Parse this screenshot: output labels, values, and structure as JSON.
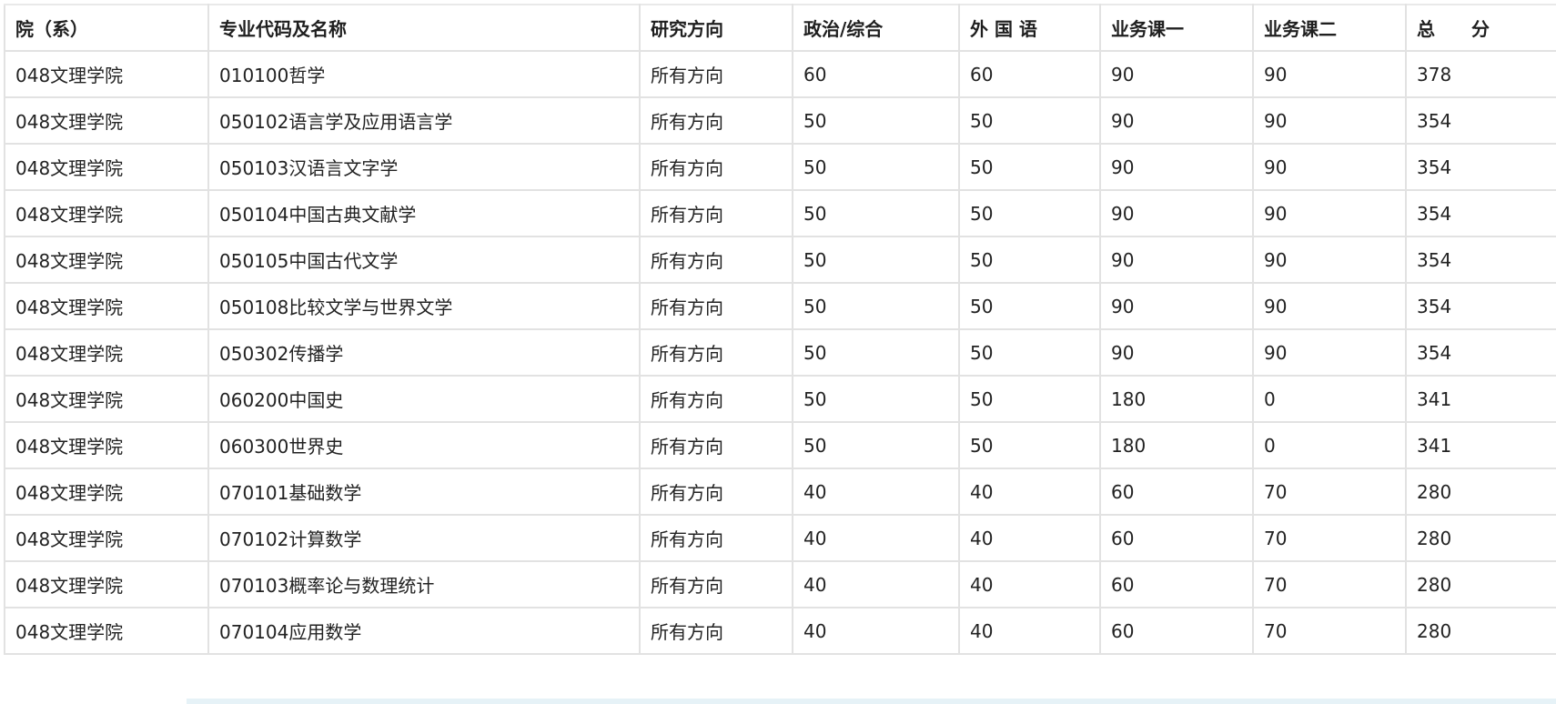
{
  "table": {
    "headers": [
      "院（系）",
      "专业代码及名称",
      "研究方向",
      "政治/综合",
      "外 国 语",
      "业务课一",
      "业务课二",
      "总　　分"
    ],
    "rows": [
      [
        "048文理学院",
        "010100哲学",
        "所有方向",
        "60",
        "60",
        "90",
        "90",
        "378"
      ],
      [
        "048文理学院",
        "050102语言学及应用语言学",
        "所有方向",
        "50",
        "50",
        "90",
        "90",
        "354"
      ],
      [
        "048文理学院",
        "050103汉语言文字学",
        "所有方向",
        "50",
        "50",
        "90",
        "90",
        "354"
      ],
      [
        "048文理学院",
        "050104中国古典文献学",
        "所有方向",
        "50",
        "50",
        "90",
        "90",
        "354"
      ],
      [
        "048文理学院",
        "050105中国古代文学",
        "所有方向",
        "50",
        "50",
        "90",
        "90",
        "354"
      ],
      [
        "048文理学院",
        "050108比较文学与世界文学",
        "所有方向",
        "50",
        "50",
        "90",
        "90",
        "354"
      ],
      [
        "048文理学院",
        "050302传播学",
        "所有方向",
        "50",
        "50",
        "90",
        "90",
        "354"
      ],
      [
        "048文理学院",
        "060200中国史",
        "所有方向",
        "50",
        "50",
        "180",
        "0",
        "341"
      ],
      [
        "048文理学院",
        "060300世界史",
        "所有方向",
        "50",
        "50",
        "180",
        "0",
        "341"
      ],
      [
        "048文理学院",
        "070101基础数学",
        "所有方向",
        "40",
        "40",
        "60",
        "70",
        "280"
      ],
      [
        "048文理学院",
        "070102计算数学",
        "所有方向",
        "40",
        "40",
        "60",
        "70",
        "280"
      ],
      [
        "048文理学院",
        "070103概率论与数理统计",
        "所有方向",
        "40",
        "40",
        "60",
        "70",
        "280"
      ],
      [
        "048文理学院",
        "070104应用数学",
        "所有方向",
        "40",
        "40",
        "60",
        "70",
        "280"
      ]
    ]
  }
}
